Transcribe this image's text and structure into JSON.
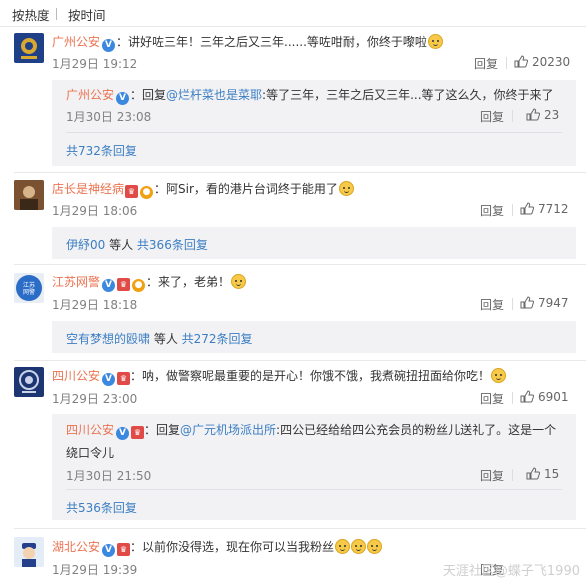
{
  "sort": {
    "hot": "按热度",
    "time": "按时间"
  },
  "comments": [
    {
      "name": "广州公安",
      "text": "：讲好咗三年！三年之后又三年......等咗咁耐，你终于嚟啦",
      "date": "1月29日 19:12",
      "reply": "回复",
      "likes": "20230",
      "sub": {
        "name": "广州公安",
        "prefix": "：回复",
        "mention": "@烂杆菜也是菜耶",
        "text": ":等了三年，三年之后又三年...等了这么久，你终于来了",
        "date": "1月30日 23:08",
        "reply": "回复",
        "likes": "23"
      },
      "more": "共732条回复"
    },
    {
      "name": "店长是神经病",
      "text": "：阿Sir，看的港片台词终于能用了",
      "date": "1月29日 18:06",
      "reply": "回复",
      "likes": "7712",
      "more_users": "伊紓00",
      "more_mid": " 等人 ",
      "more": "共366条回复"
    },
    {
      "name": "江苏网警",
      "text": "：来了，老弟！",
      "date": "1月29日 18:18",
      "reply": "回复",
      "likes": "7947",
      "more_users": "空有梦想的殴啸",
      "more_mid": " 等人 ",
      "more": "共272条回复"
    },
    {
      "name": "四川公安",
      "text": "：呐，做警察呢最重要的是开心！你饿不饿，我煮碗扭扭面给你吃！",
      "date": "1月29日 23:00",
      "reply": "回复",
      "likes": "6901",
      "sub": {
        "name": "四川公安",
        "prefix": "：回复",
        "mention": "@广元机场派出所",
        "text": ":四公已经给给四公充会员的粉丝儿送礼了。这是一个",
        "text2": "绕口令儿",
        "date": "1月30日 21:50",
        "reply": "回复",
        "likes": "15"
      },
      "more": "共536条回复"
    },
    {
      "name": "湖北公安",
      "text": "：以前你没得选，现在你可以当我粉丝",
      "date": "1月29日 19:39",
      "reply": "回复"
    }
  ],
  "watermark": "天涯社区@蝶子飞1990",
  "colors": {
    "name": "#eb7350",
    "link": "#3b7ec2",
    "vip": "#3b88e0",
    "reply_bg": "#f2f2f5"
  }
}
